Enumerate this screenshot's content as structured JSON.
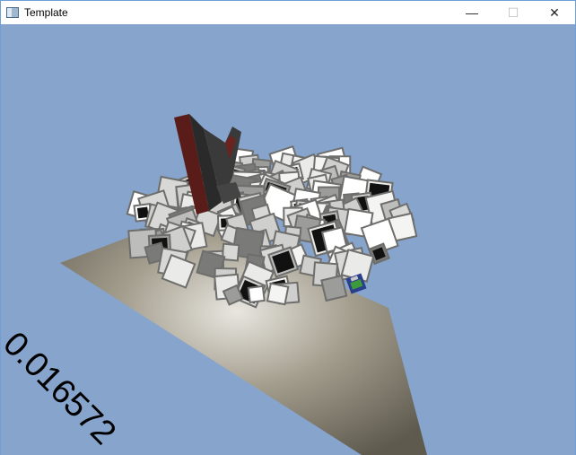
{
  "window": {
    "title": "Template",
    "icon": "app-window-icon",
    "controls": {
      "minimize": "—",
      "maximize": "☐",
      "close": "✕"
    }
  },
  "scene": {
    "background_color": "#87a4cd",
    "ground_color": "#9a9484",
    "frame_time": "0.016572"
  }
}
